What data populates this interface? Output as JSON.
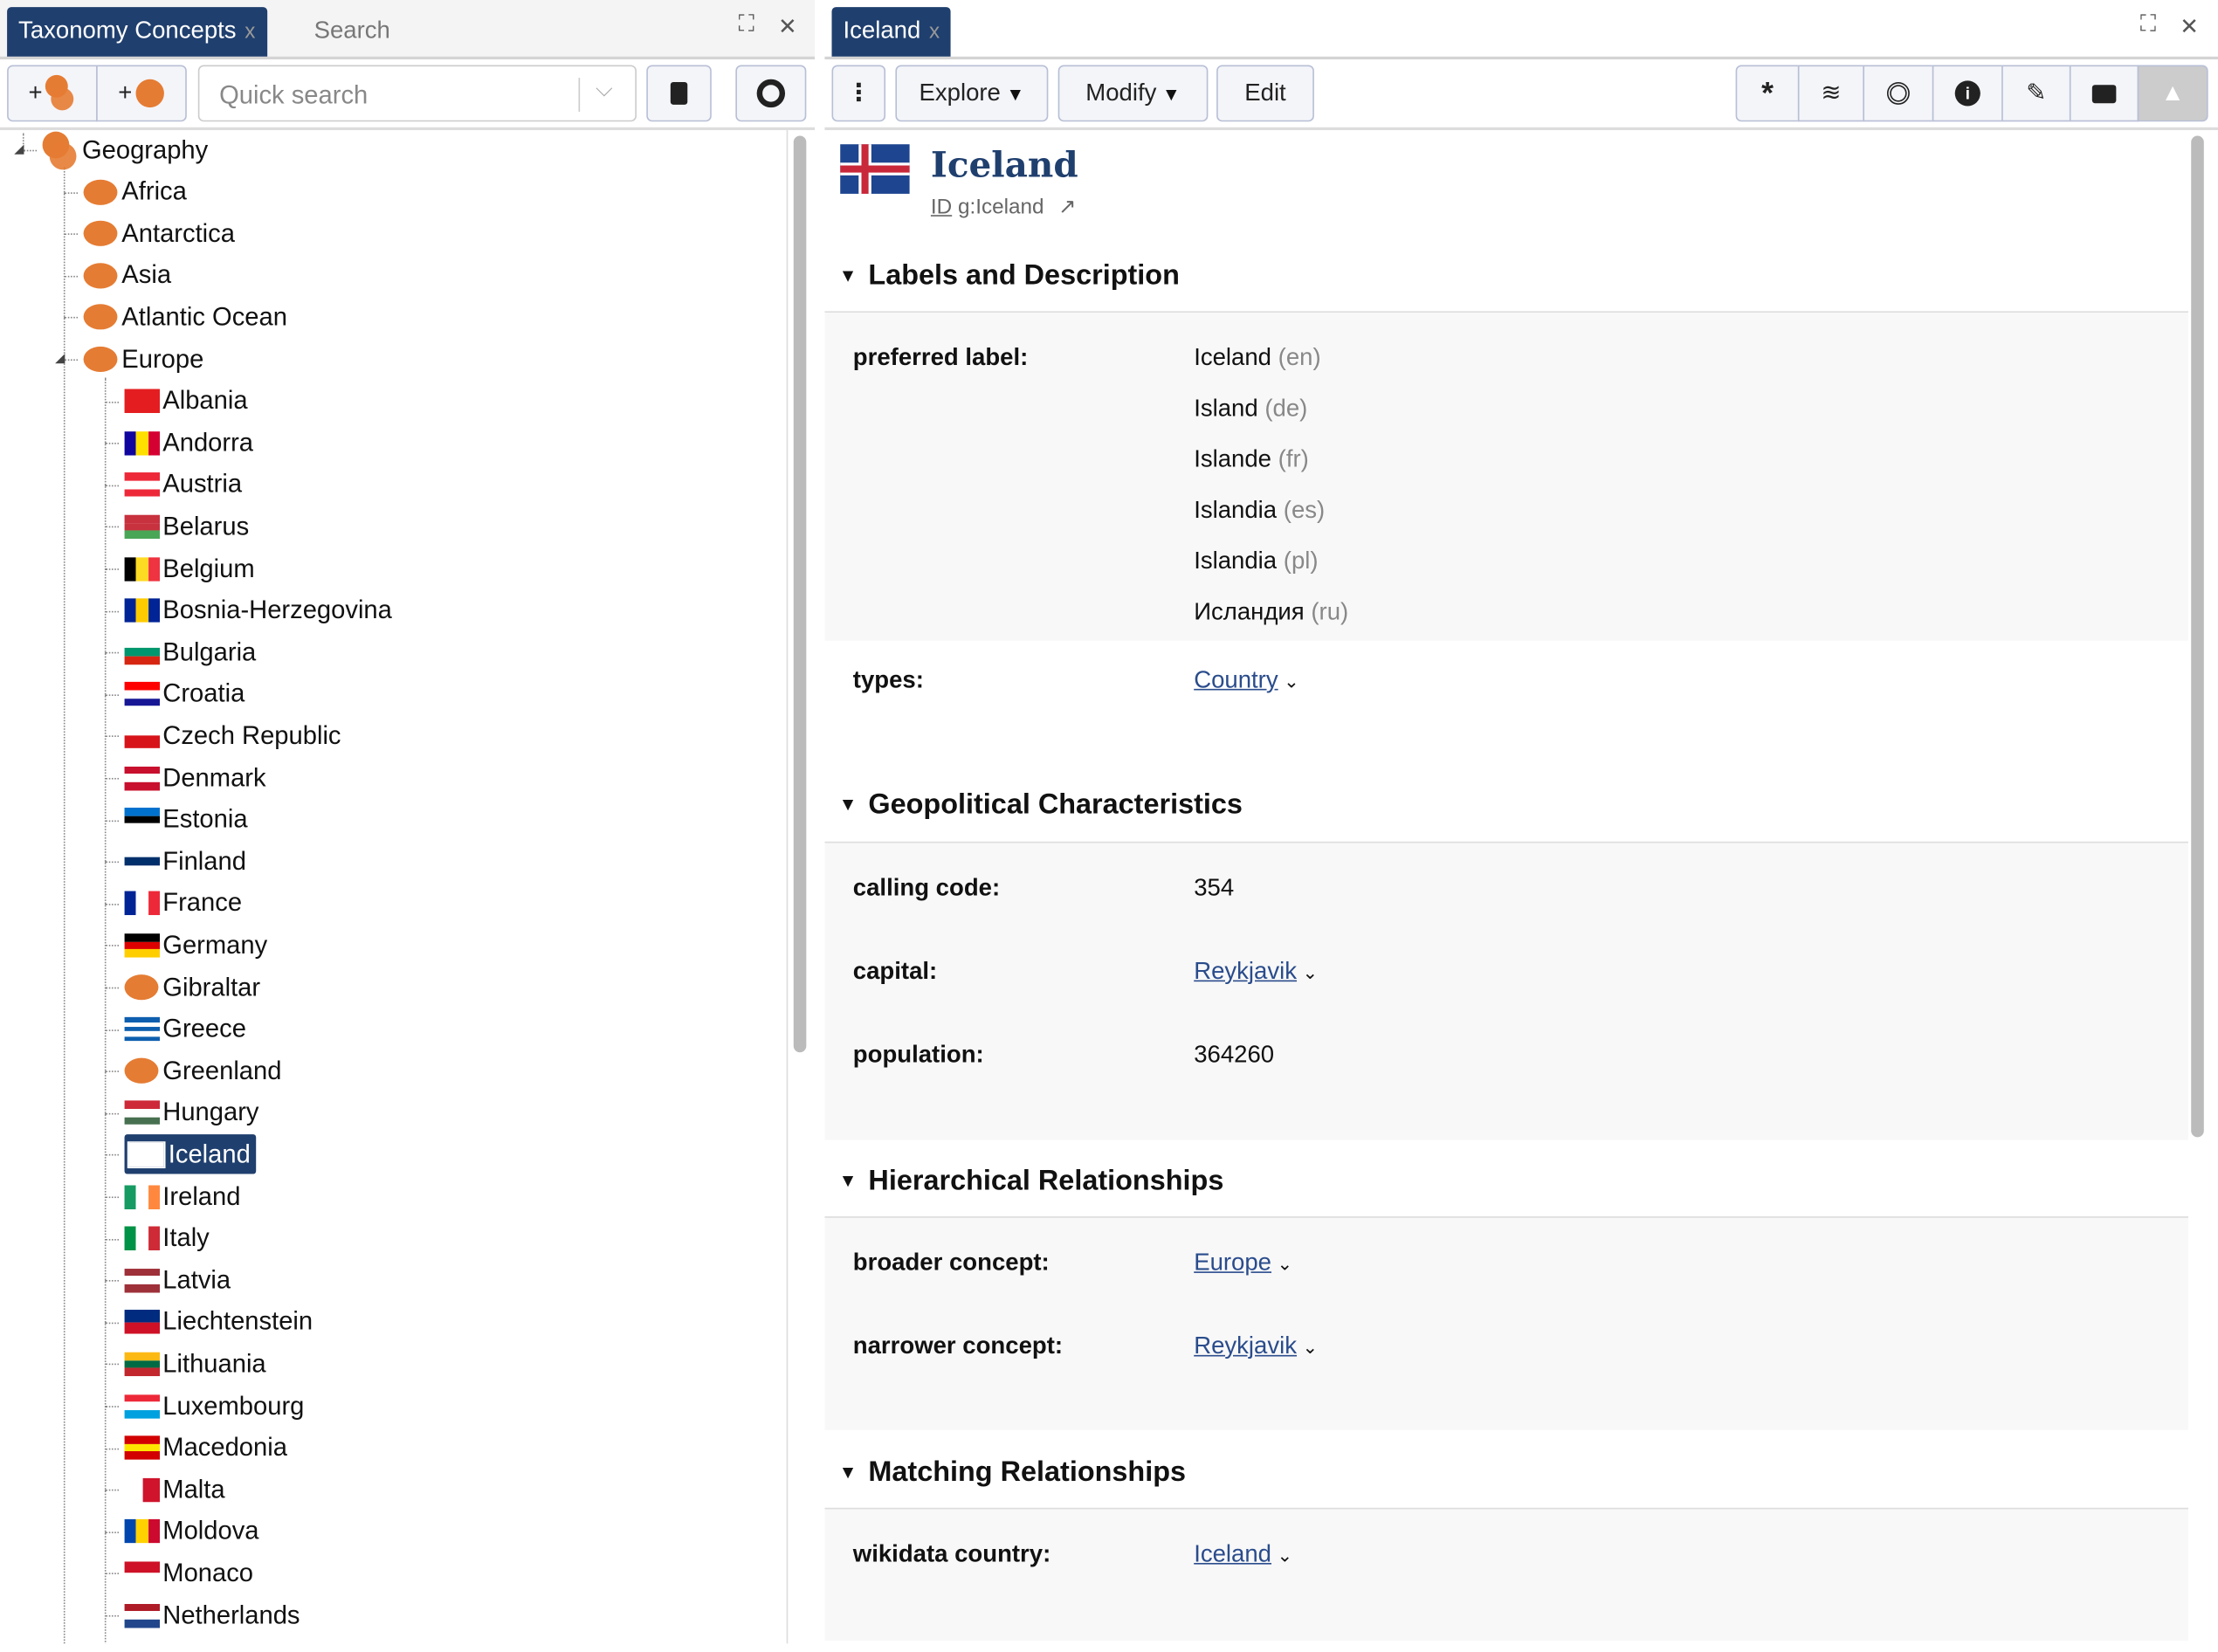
{
  "left_panel": {
    "tabs": [
      {
        "label": "Taxonomy Concepts",
        "close": "x"
      },
      {
        "label": "Search"
      }
    ],
    "window": {
      "maximize": "⛶",
      "close": "✕"
    },
    "toolbar": {
      "add_scheme": "+",
      "add_concept": "+",
      "search_placeholder": "Quick search",
      "search_value": ""
    },
    "tree": [
      {
        "label": "Geography",
        "level": 0,
        "icon": "concept-scheme"
      },
      {
        "label": "Africa",
        "level": 1,
        "icon": "concept"
      },
      {
        "label": "Antarctica",
        "level": 1,
        "icon": "concept"
      },
      {
        "label": "Asia",
        "level": 1,
        "icon": "concept"
      },
      {
        "label": "Atlantic Ocean",
        "level": 1,
        "icon": "concept"
      },
      {
        "label": "Europe",
        "level": 1,
        "icon": "concept"
      },
      {
        "label": "Albania",
        "level": 2,
        "flag": [
          "#e41e20"
        ],
        "dir": "h"
      },
      {
        "label": "Andorra",
        "level": 2,
        "flag": [
          "#10069f",
          "#fedf00",
          "#d50032"
        ],
        "dir": "v"
      },
      {
        "label": "Austria",
        "level": 2,
        "flag": [
          "#ed2939",
          "#ffffff",
          "#ed2939"
        ],
        "dir": "h"
      },
      {
        "label": "Belarus",
        "level": 2,
        "flag": [
          "#c8313e",
          "#c8313e",
          "#4aa657"
        ],
        "dir": "h"
      },
      {
        "label": "Belgium",
        "level": 2,
        "flag": [
          "#000000",
          "#fdda24",
          "#ef3340"
        ],
        "dir": "v"
      },
      {
        "label": "Bosnia-Herzegovina",
        "level": 2,
        "flag": [
          "#002395",
          "#fecb00",
          "#002395"
        ],
        "dir": "v"
      },
      {
        "label": "Bulgaria",
        "level": 2,
        "flag": [
          "#ffffff",
          "#00966e",
          "#d62612"
        ],
        "dir": "h"
      },
      {
        "label": "Croatia",
        "level": 2,
        "flag": [
          "#ff0000",
          "#ffffff",
          "#171796"
        ],
        "dir": "h"
      },
      {
        "label": "Czech Republic",
        "level": 2,
        "flag": [
          "#ffffff",
          "#d7141a"
        ],
        "dir": "h"
      },
      {
        "label": "Denmark",
        "level": 2,
        "flag": [
          "#c8102e",
          "#ffffff",
          "#c8102e"
        ],
        "dir": "h"
      },
      {
        "label": "Estonia",
        "level": 2,
        "flag": [
          "#0072ce",
          "#000000",
          "#ffffff"
        ],
        "dir": "h"
      },
      {
        "label": "Finland",
        "level": 2,
        "flag": [
          "#ffffff",
          "#002f6c",
          "#ffffff"
        ],
        "dir": "h"
      },
      {
        "label": "France",
        "level": 2,
        "flag": [
          "#002395",
          "#ffffff",
          "#ed2939"
        ],
        "dir": "v"
      },
      {
        "label": "Germany",
        "level": 2,
        "flag": [
          "#000000",
          "#dd0000",
          "#ffce00"
        ],
        "dir": "h"
      },
      {
        "label": "Gibraltar",
        "level": 2,
        "icon": "concept"
      },
      {
        "label": "Greece",
        "level": 2,
        "flag": [
          "#0d5eaf",
          "#ffffff",
          "#0d5eaf",
          "#ffffff",
          "#0d5eaf"
        ],
        "dir": "h"
      },
      {
        "label": "Greenland",
        "level": 2,
        "icon": "concept"
      },
      {
        "label": "Hungary",
        "level": 2,
        "flag": [
          "#ce2939",
          "#ffffff",
          "#477050"
        ],
        "dir": "h"
      },
      {
        "label": "Iceland",
        "level": 2,
        "flag": [
          "#ffffff"
        ],
        "dir": "h",
        "selected": true
      },
      {
        "label": "Ireland",
        "level": 2,
        "flag": [
          "#169b62",
          "#ffffff",
          "#ff883e"
        ],
        "dir": "v"
      },
      {
        "label": "Italy",
        "level": 2,
        "flag": [
          "#009246",
          "#ffffff",
          "#ce2b37"
        ],
        "dir": "v"
      },
      {
        "label": "Latvia",
        "level": 2,
        "flag": [
          "#9e3039",
          "#ffffff",
          "#9e3039"
        ],
        "dir": "h"
      },
      {
        "label": "Liechtenstein",
        "level": 2,
        "flag": [
          "#002b7f",
          "#ce1126"
        ],
        "dir": "h"
      },
      {
        "label": "Lithuania",
        "level": 2,
        "flag": [
          "#fdb913",
          "#006a44",
          "#c1272d"
        ],
        "dir": "h"
      },
      {
        "label": "Luxembourg",
        "level": 2,
        "flag": [
          "#ed2939",
          "#ffffff",
          "#00a1de"
        ],
        "dir": "h"
      },
      {
        "label": "Macedonia",
        "level": 2,
        "flag": [
          "#d20000",
          "#ffe600",
          "#d20000"
        ],
        "dir": "h"
      },
      {
        "label": "Malta",
        "level": 2,
        "flag": [
          "#ffffff",
          "#cf142b"
        ],
        "dir": "v"
      },
      {
        "label": "Moldova",
        "level": 2,
        "flag": [
          "#0046ae",
          "#ffd200",
          "#cc092f"
        ],
        "dir": "v"
      },
      {
        "label": "Monaco",
        "level": 2,
        "flag": [
          "#ce1126",
          "#ffffff"
        ],
        "dir": "h"
      },
      {
        "label": "Netherlands",
        "level": 2,
        "flag": [
          "#ae1c28",
          "#ffffff",
          "#21468b"
        ],
        "dir": "h"
      }
    ]
  },
  "right_panel": {
    "tab": {
      "label": "Iceland",
      "close": "x"
    },
    "window": {
      "maximize": "⛶",
      "close": "✕"
    },
    "toolbar": {
      "menu": "⋮",
      "explore": "Explore",
      "modify": "Modify",
      "edit": "Edit"
    },
    "header": {
      "title": "Iceland",
      "id_label": "ID",
      "id_value": "g:Iceland"
    },
    "sections": {
      "labels": {
        "title": "Labels and Description",
        "preferred_label": "preferred label:",
        "pref_labels": [
          {
            "text": "Iceland",
            "lang": "(en)"
          },
          {
            "text": "Island",
            "lang": "(de)"
          },
          {
            "text": "Islande",
            "lang": "(fr)"
          },
          {
            "text": "Islandia",
            "lang": "(es)"
          },
          {
            "text": "Islandia",
            "lang": "(pl)"
          },
          {
            "text": "Исландия",
            "lang": "(ru)"
          }
        ],
        "types_label": "types:",
        "types_value": "Country"
      },
      "geo": {
        "title": "Geopolitical Characteristics",
        "calling_code_label": "calling code:",
        "calling_code": "354",
        "capital_label": "capital:",
        "capital": "Reykjavik",
        "population_label": "population:",
        "population": "364260"
      },
      "hier": {
        "title": "Hierarchical Relationships",
        "broader_label": "broader concept:",
        "broader": "Europe",
        "narrower_label": "narrower concept:",
        "narrower": "Reykjavik"
      },
      "match": {
        "title": "Matching Relationships",
        "wikidata_label": "wikidata country:",
        "wikidata": "Iceland"
      }
    }
  }
}
